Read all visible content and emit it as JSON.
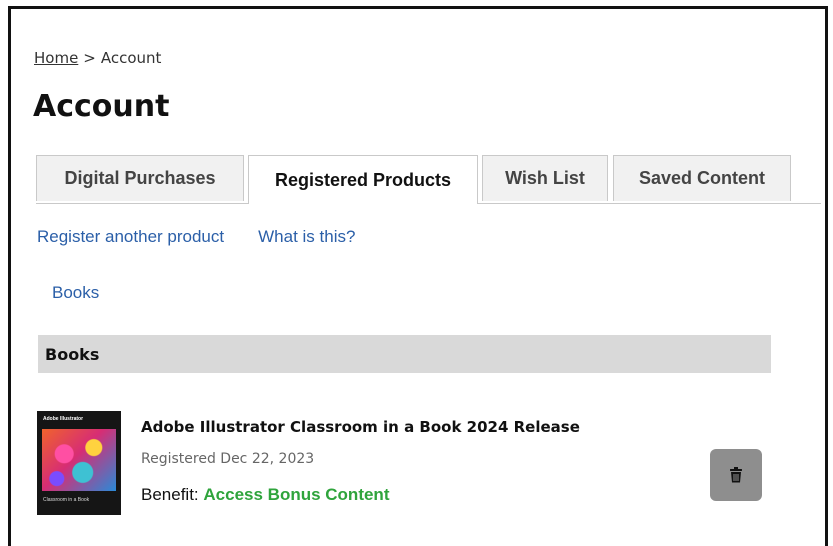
{
  "breadcrumb": {
    "home_label": "Home",
    "separator": ">",
    "current_label": "Account"
  },
  "page": {
    "title": "Account"
  },
  "tabs": [
    {
      "label": "Digital Purchases",
      "active": false
    },
    {
      "label": "Registered Products",
      "active": true
    },
    {
      "label": "Wish List",
      "active": false
    },
    {
      "label": "Saved Content",
      "active": false
    }
  ],
  "actions": {
    "register_label": "Register another product",
    "what_label": "What is this?"
  },
  "filters": {
    "books_label": "Books"
  },
  "section": {
    "title": "Books"
  },
  "product": {
    "title": "Adobe Illustrator Classroom in a Book 2024 Release",
    "registered": "Registered Dec 22, 2023",
    "benefit_prefix": "Benefit:",
    "benefit_link": "Access Bonus Content",
    "cover_brand": "Adobe",
    "cover_product": "Illustrator",
    "cover_subtitle": "Classroom in a Book",
    "delete_icon": "trash-icon"
  },
  "colors": {
    "link": "#2b5fa8",
    "benefit": "#2fa43c",
    "section_bg": "#d9d9d9",
    "delete_bg": "#8e8e8e"
  }
}
